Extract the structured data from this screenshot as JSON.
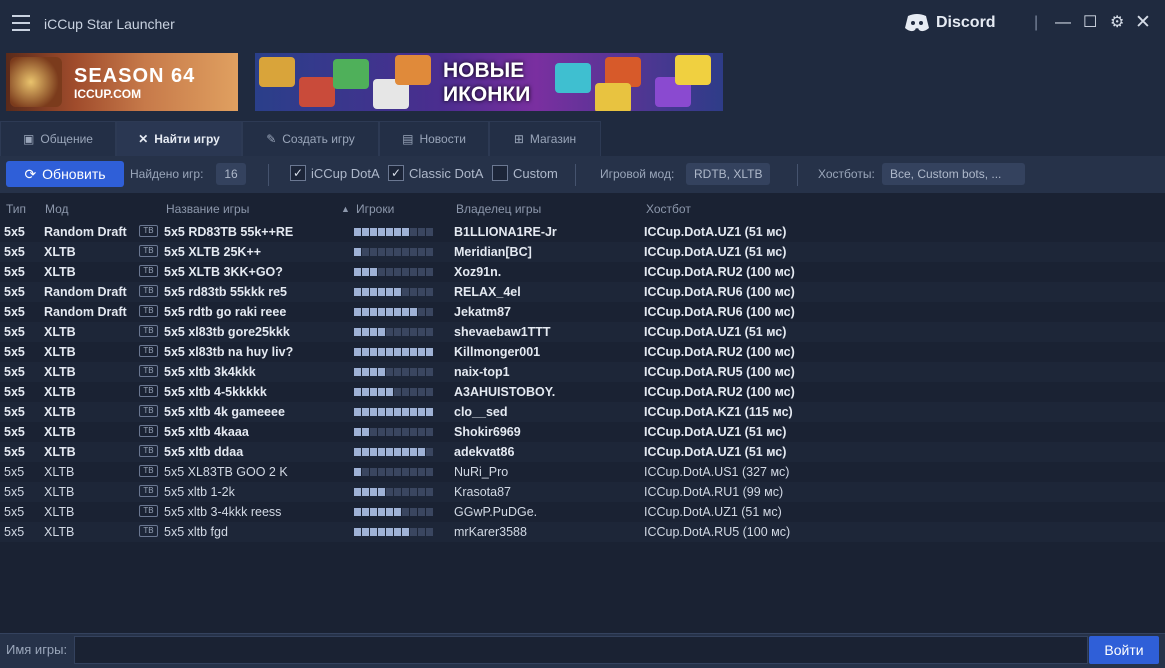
{
  "app": {
    "title": "iCCup Star Launcher",
    "discord_label": "Discord"
  },
  "banners": {
    "season": {
      "title": "SEASON 64",
      "url": "ICCUP.COM"
    },
    "icons": {
      "line1": "НОВЫЕ",
      "line2": "ИКОНКИ"
    }
  },
  "tabs": [
    {
      "label": "Общение",
      "icon": "chat-icon",
      "glyph": "▣"
    },
    {
      "label": "Найти игру",
      "icon": "swords-icon",
      "glyph": "✕"
    },
    {
      "label": "Создать игру",
      "icon": "create-icon",
      "glyph": "✎"
    },
    {
      "label": "Новости",
      "icon": "news-icon",
      "glyph": "▤"
    },
    {
      "label": "Магазин",
      "icon": "cart-icon",
      "glyph": "⊞"
    }
  ],
  "toolbar": {
    "refresh_label": "Обновить",
    "found_label": "Найдено игр:",
    "found_count": "16",
    "filters": [
      {
        "label": "iCCup DotA",
        "checked": true
      },
      {
        "label": "Classic DotA",
        "checked": true
      },
      {
        "label": "Custom",
        "checked": false
      }
    ],
    "mode_label": "Игровой мод:",
    "mode_value": "RDTB, XLTB",
    "hostbots_label": "Хостботы:",
    "hostbots_value": "Все, Custom bots, ..."
  },
  "columns": {
    "type": "Тип",
    "mode": "Мод",
    "name": "Название игры",
    "players": "Игроки",
    "owner": "Владелец игры",
    "host": "Хостбот"
  },
  "games": [
    {
      "type": "5x5",
      "mode": "Random Draft",
      "name": "5x5 RD83TB 55k++RE",
      "players": 7,
      "owner": "B1LLIONA1RE-Jr",
      "host": "ICCup.DotA.UZ1 (51 мс)",
      "bold": true
    },
    {
      "type": "5x5",
      "mode": "XLTB",
      "name": "5x5 XLTB 25K++",
      "players": 1,
      "owner": "Meridian[BC]",
      "host": "ICCup.DotA.UZ1 (51 мс)",
      "bold": true
    },
    {
      "type": "5x5",
      "mode": "XLTB",
      "name": "5x5 XLTB 3KK+GO?",
      "players": 3,
      "owner": "Xoz91n.",
      "host": "ICCup.DotA.RU2 (100 мс)",
      "bold": true
    },
    {
      "type": "5x5",
      "mode": "Random Draft",
      "name": "5x5 rd83tb 55kkk re5",
      "players": 6,
      "owner": "RELAX_4el",
      "host": "ICCup.DotA.RU6 (100 мс)",
      "bold": true
    },
    {
      "type": "5x5",
      "mode": "Random Draft",
      "name": "5x5 rdtb go raki reee",
      "players": 8,
      "owner": "Jekatm87",
      "host": "ICCup.DotA.RU6 (100 мс)",
      "bold": true
    },
    {
      "type": "5x5",
      "mode": "XLTB",
      "name": "5x5 xl83tb gore25kkk",
      "players": 4,
      "owner": "shevaebaw1TTT",
      "host": "ICCup.DotA.UZ1 (51 мс)",
      "bold": true
    },
    {
      "type": "5x5",
      "mode": "XLTB",
      "name": "5x5 xl83tb na huy liv?",
      "players": 10,
      "owner": "Killmonger001",
      "host": "ICCup.DotA.RU2 (100 мс)",
      "bold": true
    },
    {
      "type": "5x5",
      "mode": "XLTB",
      "name": "5x5 xltb 3k4kkk",
      "players": 4,
      "owner": "naix-top1",
      "host": "ICCup.DotA.RU5 (100 мс)",
      "bold": true
    },
    {
      "type": "5x5",
      "mode": "XLTB",
      "name": "5x5 xltb 4-5kkkkk",
      "players": 5,
      "owner": "A3AHUISTOBOY.",
      "host": "ICCup.DotA.RU2 (100 мс)",
      "bold": true
    },
    {
      "type": "5x5",
      "mode": "XLTB",
      "name": "5x5 xltb 4k gameeee",
      "players": 10,
      "owner": "clo__sed",
      "host": "ICCup.DotA.KZ1 (115 мс)",
      "bold": true
    },
    {
      "type": "5x5",
      "mode": "XLTB",
      "name": "5x5 xltb 4kaaa",
      "players": 2,
      "owner": "Shokir6969",
      "host": "ICCup.DotA.UZ1 (51 мс)",
      "bold": true
    },
    {
      "type": "5x5",
      "mode": "XLTB",
      "name": "5x5 xltb ddaa",
      "players": 9,
      "owner": "adekvat86",
      "host": "ICCup.DotA.UZ1 (51 мс)",
      "bold": true
    },
    {
      "type": "5x5",
      "mode": "XLTB",
      "name": "5x5 XL83TB GOO 2 K",
      "players": 1,
      "owner": "NuRi_Pro",
      "host": "ICCup.DotA.US1 (327 мс)",
      "bold": false
    },
    {
      "type": "5x5",
      "mode": "XLTB",
      "name": "5x5 xltb 1-2k",
      "players": 4,
      "owner": "Krasota87",
      "host": "ICCup.DotA.RU1 (99 мс)",
      "bold": false
    },
    {
      "type": "5x5",
      "mode": "XLTB",
      "name": "5x5 xltb 3-4kkk reess",
      "players": 6,
      "owner": "GGwP.PuDGe.",
      "host": "ICCup.DotA.UZ1 (51 мс)",
      "bold": false
    },
    {
      "type": "5x5",
      "mode": "XLTB",
      "name": "5x5 xltb fgd",
      "players": 7,
      "owner": "mrKarer3588",
      "host": "ICCup.DotA.RU5 (100 мс)",
      "bold": false
    }
  ],
  "bottom": {
    "name_label": "Имя игры:",
    "name_value": "",
    "join_label": "Войти"
  }
}
